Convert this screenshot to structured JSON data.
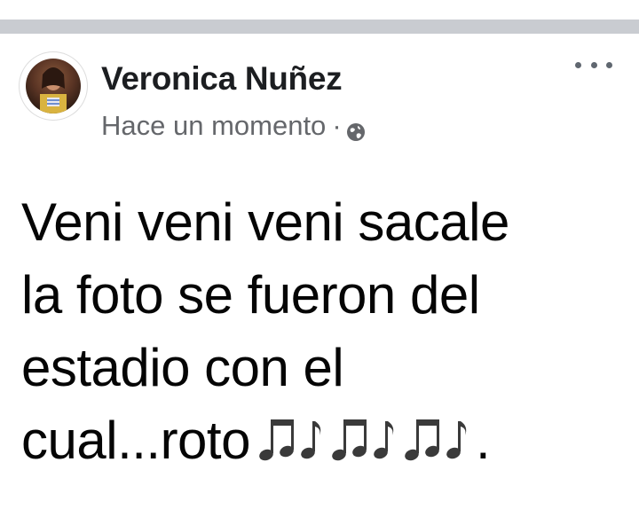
{
  "post": {
    "author": "Veronica Nuñez",
    "timestamp": "Hace un momento",
    "separator": "·",
    "privacy_icon": "globe-icon",
    "more_icon": "more-options-icon",
    "message_lines": [
      "Veni veni veni sacale",
      "la foto se fueron del",
      "estadio con el",
      "cual...roto"
    ],
    "message_emojis": [
      "musical-notes",
      "musical-notes",
      "musical-notes"
    ],
    "message_trailing": "."
  },
  "colors": {
    "divider": "#c9ccd1",
    "author_text": "#1c1e21",
    "meta_text": "#65676b",
    "message_text": "#050505"
  }
}
